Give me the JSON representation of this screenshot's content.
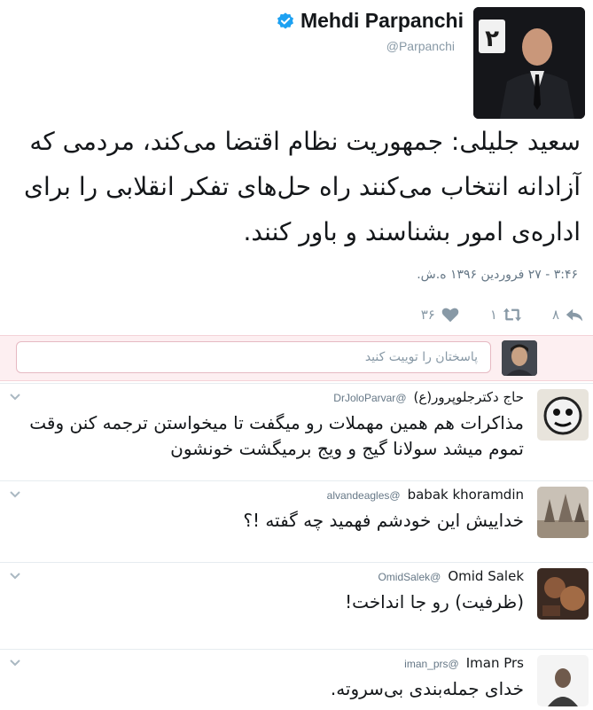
{
  "tweet": {
    "display_name": "Mehdi Parpanchi",
    "handle": "@Parpanchi",
    "avatar_digit": "۲",
    "text": "سعید جلیلی: جمهوریت نظام اقتضا می‌کند، مردمی که آزادانه انتخاب می‌کنند راه حل‌های تفکر انقلابی را برای اداره‌ی امور بشناسند و  باور کنند.",
    "timestamp": "۳:۴۶ - ۲۷ فروردین ۱۳۹۶ ه.ش.",
    "reply_count": "۸",
    "retweet_count": "۱",
    "like_count": "۳۶"
  },
  "reply_box": {
    "placeholder": "پاسختان را توییت کنید"
  },
  "replies": [
    {
      "name": "حاج دکترجلوپرور(ع)",
      "handle": "@DrJoloParvar",
      "text": "مذاکرات هم همین مهملات رو میگفت تا میخواستن ترجمه کنن وقت تموم میشد سولانا گیج و ویج برمیگشت خونشون"
    },
    {
      "name": "babak khoramdin",
      "handle": "@alvandeagles",
      "text": "خداییش این خودشم فهمید چه گفته !؟"
    },
    {
      "name": "Omid Salek",
      "handle": "@OmidSalek",
      "text": "(ظرفیت) رو جا انداخت!"
    },
    {
      "name": "Iman Prs",
      "handle": "@iman_prs",
      "text": "خدای جمله‌بندی بی‌سروته."
    }
  ],
  "colors": {
    "accent": "#1da1f2",
    "secondary_text": "#8899a6",
    "reply_box_bg": "#fdeff1"
  },
  "icons": [
    "verified-icon",
    "reply-icon",
    "retweet-icon",
    "like-icon",
    "chevron-down-icon"
  ]
}
